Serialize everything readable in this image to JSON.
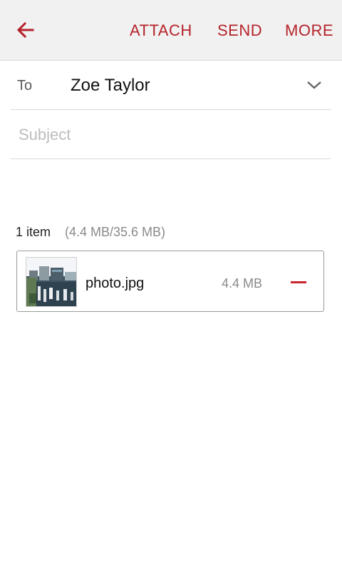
{
  "toolbar": {
    "back_icon": "arrow-back-icon",
    "attach_label": "ATTACH",
    "send_label": "SEND",
    "more_label": "MORE",
    "accent_color": "#b5232b"
  },
  "recipient": {
    "label": "To",
    "value": "Zoe Taylor",
    "dropdown_icon": "chevron-down-icon"
  },
  "subject": {
    "placeholder": "Subject",
    "value": ""
  },
  "attachments": {
    "count_label": "1 item",
    "size_summary": "(4.4 MB/35.6 MB)",
    "items": [
      {
        "thumbnail": "photo-thumbnail",
        "name": "photo.jpg",
        "size": "4.4 MB",
        "remove_icon": "minus-icon"
      }
    ]
  }
}
